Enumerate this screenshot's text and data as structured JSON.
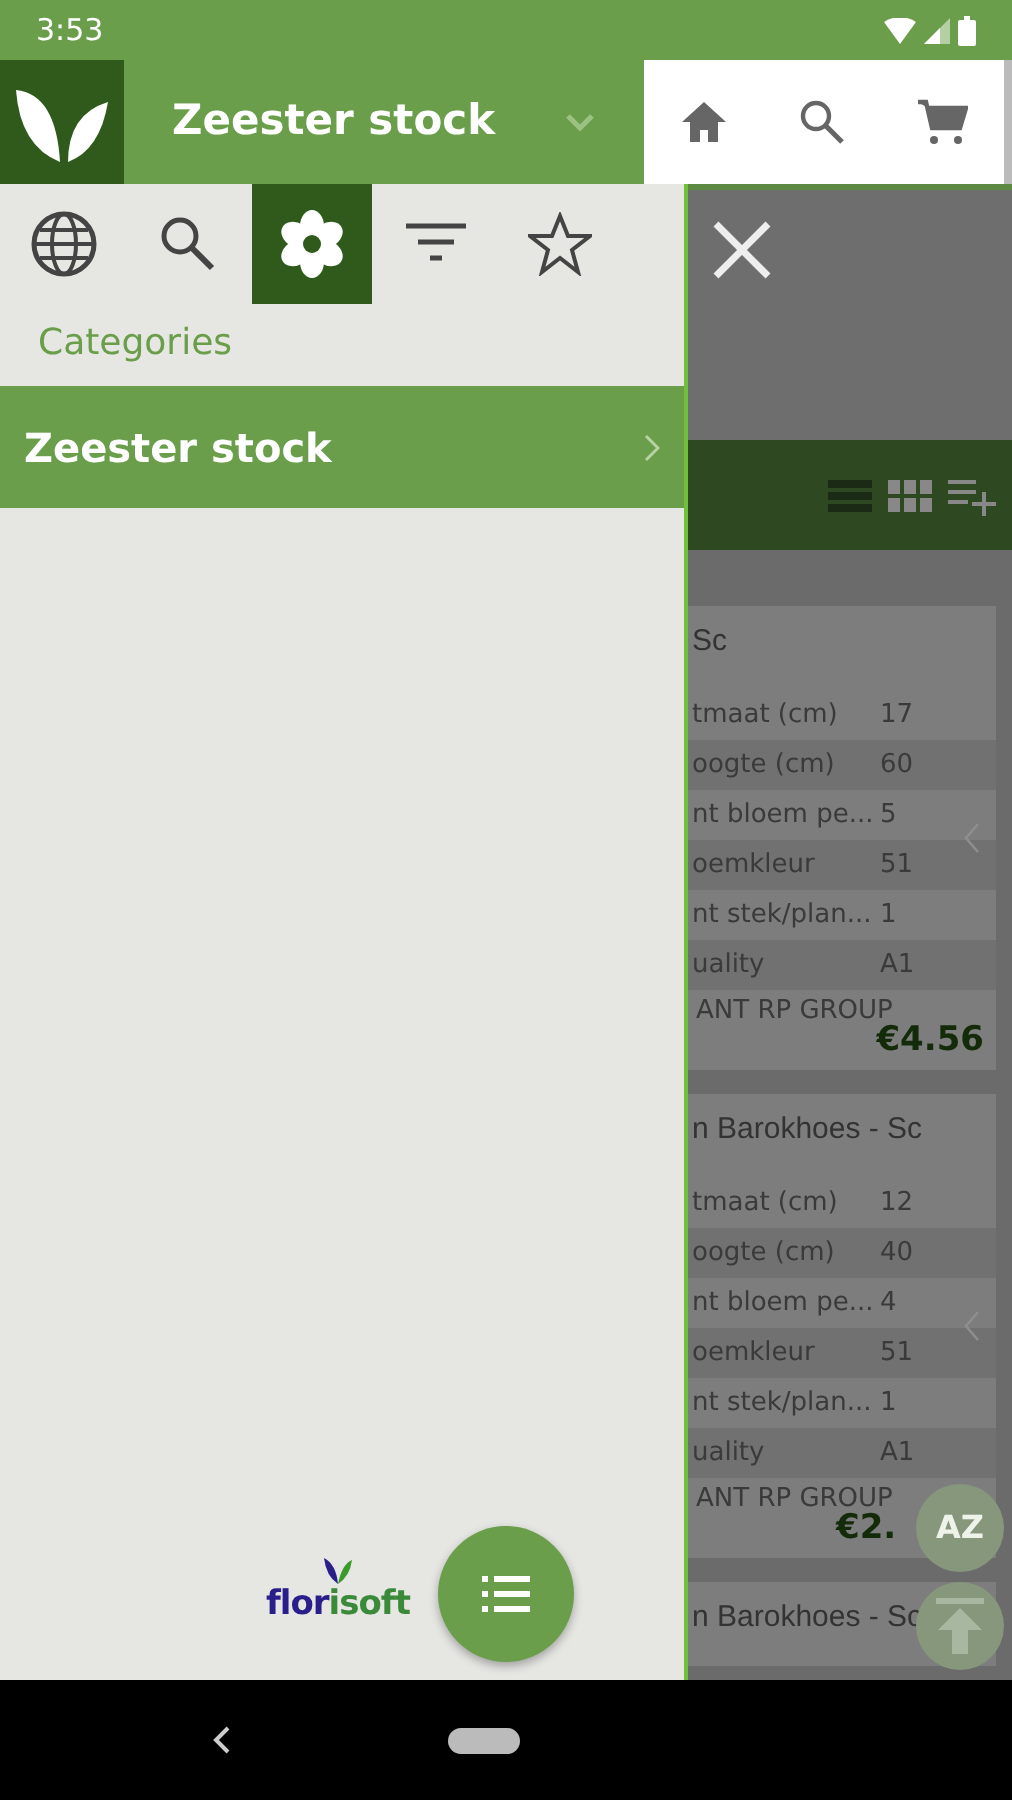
{
  "status_bar": {
    "time": "3:53"
  },
  "app_bar": {
    "title": "Zeester stock"
  },
  "drawer": {
    "tabs": [
      {
        "selected": false
      },
      {
        "selected": false
      },
      {
        "selected": true
      },
      {
        "selected": false
      },
      {
        "selected": false
      }
    ],
    "heading": "Categories",
    "categories": [
      {
        "label": "Zeester stock"
      }
    ],
    "brand": {
      "parts": [
        "flor",
        "isoft"
      ]
    }
  },
  "background": {
    "cards": [
      {
        "title": "Sc",
        "specs": [
          {
            "label": "tmaat (cm)",
            "value": "17"
          },
          {
            "label": "oogte (cm)",
            "value": "60"
          },
          {
            "label": "nt bloem pe...",
            "value": "5"
          },
          {
            "label": "oemkleur",
            "value": "51"
          },
          {
            "label": "nt stek/plan...",
            "value": "1"
          },
          {
            "label": "uality",
            "value": "A1"
          }
        ],
        "supplier": "ANT RP GROUP",
        "price": "€4.56"
      },
      {
        "title": "n Barokhoes - Sc",
        "specs": [
          {
            "label": "tmaat (cm)",
            "value": "12"
          },
          {
            "label": "oogte (cm)",
            "value": "40"
          },
          {
            "label": "nt bloem pe...",
            "value": "4"
          },
          {
            "label": "oemkleur",
            "value": "51"
          },
          {
            "label": "nt stek/plan...",
            "value": "1"
          },
          {
            "label": "uality",
            "value": "A1"
          }
        ],
        "supplier": "ANT RP GROUP",
        "price": "€2."
      },
      {
        "title": "n Barokhoes - Sc"
      }
    ]
  },
  "sort_button": {
    "label": "AZ"
  }
}
